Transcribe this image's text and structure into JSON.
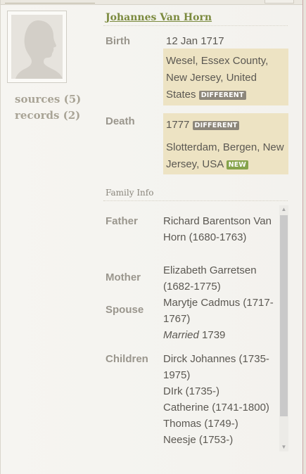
{
  "person": {
    "name": "Johannes Van Horn"
  },
  "side_links": {
    "sources": "sources (5)",
    "records": "records (2)"
  },
  "birth": {
    "label": "Birth",
    "date": "12 Jan 1717",
    "place_lines": [
      "Wesel, Essex County,",
      "New Jersey, United",
      "States"
    ],
    "place_badge": "DIFFERENT"
  },
  "death": {
    "label": "Death",
    "date": "1777",
    "date_badge": "DIFFERENT",
    "place_lines": [
      "Slotterdam, Bergen, New",
      "Jersey, USA"
    ],
    "place_badge": "NEW"
  },
  "family": {
    "title": "Family Info",
    "father_label": "Father",
    "father_lines": [
      "Richard Barentson Van",
      "Horn (1680-1763)"
    ],
    "mother_label": "Mother",
    "mother_lines": [
      "Elizabeth Garretsen",
      "(1682-1775)"
    ],
    "spouse_label": "Spouse",
    "spouse_lines": [
      "Marytje Cadmus (1717-",
      "1767)"
    ],
    "married_word": "Married",
    "married_year": "1739",
    "children_label": "Children",
    "children_lines": [
      "Dirck Johannes (1735-",
      "1975)",
      "DIrk (1735-)",
      "Catherine (1741-1800)",
      "Thomas (1749-)",
      "Neesje (1753-)"
    ]
  },
  "colors": {
    "name_link": "#7b8a3e",
    "highlight": "#ede3c3",
    "badge_different": "#8c867a",
    "badge_new": "#86a34b"
  },
  "icons": {
    "portrait": "silhouette-placeholder-icon",
    "scroll_up": "scroll-up-arrow-icon",
    "scroll_down": "scroll-down-arrow-icon"
  }
}
